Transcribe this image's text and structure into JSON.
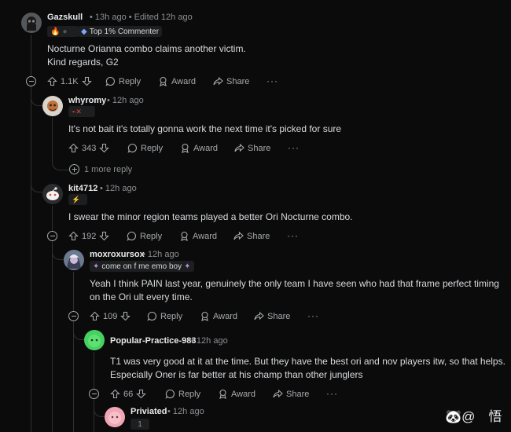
{
  "comments": [
    {
      "user": "Gazskull",
      "time": "13h ago",
      "edited": "Edited 12h ago",
      "badge": "Top 1% Commenter",
      "lines": [
        "Nocturne Orianna combo claims another victim.",
        "Kind regards, G2"
      ],
      "votes": "1.1K"
    },
    {
      "user": "whyromy",
      "time": "12h ago",
      "lines": [
        "It's not bait it's totally gonna work the next time it's picked for sure"
      ],
      "votes": "343",
      "more_replies": "1 more reply"
    },
    {
      "user": "kit4712",
      "time": "12h ago",
      "lines": [
        "I swear the minor region teams played a better Ori Nocturne combo."
      ],
      "votes": "192"
    },
    {
      "user": "moxroxursox",
      "time": "12h ago",
      "flair_text": "come on f me emo boy",
      "lines": [
        "Yeah I think PAIN last year, genuinely the only team I have seen who had that frame perfect timing",
        "on the Ori ult every time."
      ],
      "votes": "109"
    },
    {
      "user": "Popular-Practice-983",
      "time": "12h ago",
      "lines": [
        "T1 was very good at it at the time. But they have the best ori and nov players itw, so that helps.",
        "Especially Oner is far better at his champ than other junglers"
      ],
      "votes": "66"
    },
    {
      "user": "Priviated",
      "time": "12h ago",
      "flair_text": "1"
    }
  ],
  "actions": {
    "reply": "Reply",
    "award": "Award",
    "share": "Share",
    "more": "···"
  },
  "separator": "•",
  "watermark": "🐼@　悟",
  "colors": {
    "bg": "#0b0b0c",
    "text": "#d7dadc",
    "muted": "#8b8f92",
    "line": "#2e3133",
    "badge": "#7aa7ff"
  }
}
